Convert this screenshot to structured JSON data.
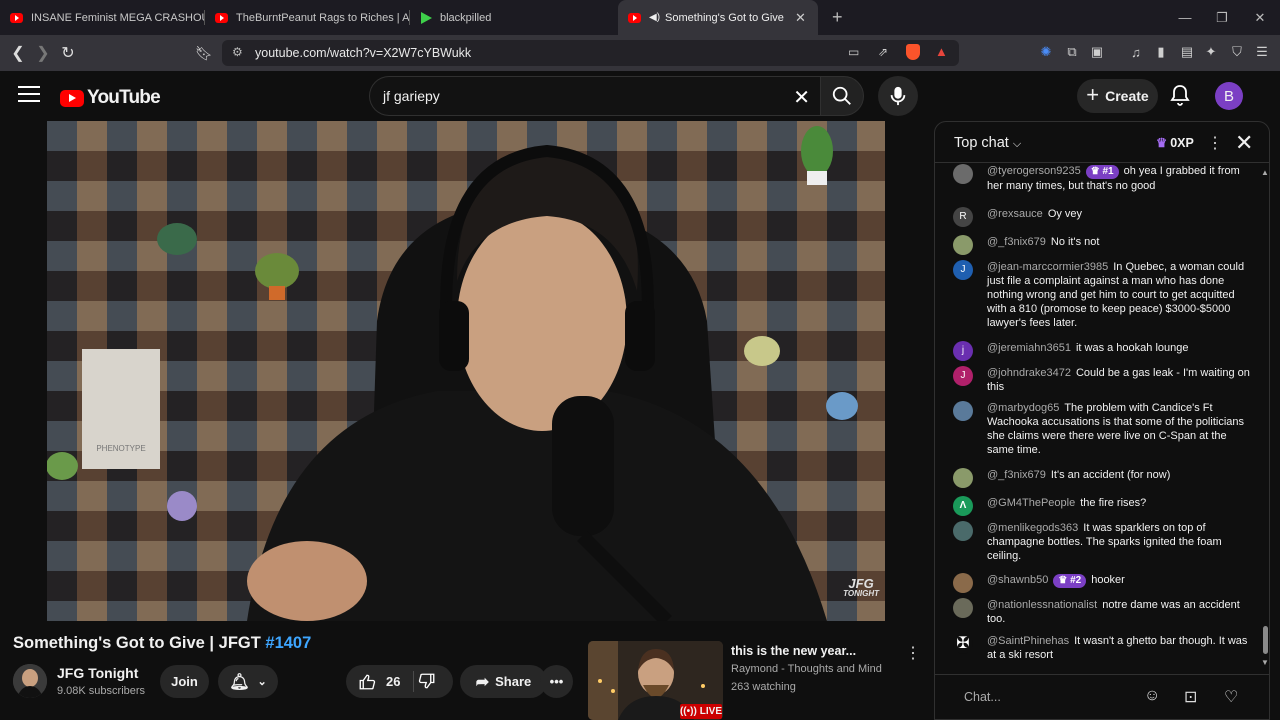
{
  "browser": {
    "tabs": [
      {
        "title": "INSANE Feminist MEGA CRASHOUT",
        "icon": "youtube-icon"
      },
      {
        "title": "TheBurntPeanut Rags to Riches | ARC",
        "icon": "youtube-icon"
      },
      {
        "title": "blackpilled",
        "icon": "rumble-icon"
      },
      {
        "title": "Something's Got to Give | JFG",
        "icon": "youtube-icon",
        "active": true
      }
    ],
    "url": "youtube.com/watch?v=X2W7cYBWukk"
  },
  "youtube": {
    "logo_text": "YouTube",
    "search_value": "jf gariepy",
    "create_label": "Create",
    "avatar_letter": "B",
    "video": {
      "title": "Something's Got to Give | JFGT",
      "hashtag": "#1407",
      "watermark_line1": "JFG",
      "watermark_line2": "TONIGHT"
    },
    "channel": {
      "name": "JFG Tonight",
      "subscribers": "9.08K subscribers"
    },
    "actions": {
      "join": "Join",
      "likes": "26",
      "share": "Share"
    },
    "up_next": {
      "title": "this is the new year...",
      "channel": "Raymond - Thoughts and Mind",
      "watching": "263 watching",
      "live_label": "LIVE"
    }
  },
  "chat": {
    "header": "Top chat",
    "xp": "0XP",
    "input_placeholder": "Chat...",
    "messages": [
      {
        "author": "@tyerogerson9235",
        "badge": "#1",
        "text": "oh yea I grabbed it from her many times, but that's no good",
        "avatar_color": "#6b6b6b",
        "avatar_letter": ""
      },
      {
        "author": "@rexsauce",
        "text": "Oy vey",
        "avatar_color": "#444",
        "avatar_letter": "R"
      },
      {
        "author": "@_f3nix679",
        "text": "No it's not",
        "avatar_color": "#8a9a6a",
        "avatar_letter": ""
      },
      {
        "author": "@jean-marccormier3985",
        "text": "In Quebec, a woman could just file a complaint against a man who has done nothing wrong and get him to court to get acquitted with a 810 (promose to keep peace) $3000-$5000 lawyer's fees later.",
        "avatar_color": "#1f5fb0",
        "avatar_letter": "J"
      },
      {
        "author": "@jeremiahn3651",
        "text": "it was a hookah lounge",
        "avatar_color": "#6a2fb0",
        "avatar_letter": "j"
      },
      {
        "author": "@johndrake3472",
        "text": "Could be a gas leak - I'm waiting on this",
        "avatar_color": "#b0206a",
        "avatar_letter": "J"
      },
      {
        "author": "@marbydog65",
        "text": "The problem with Candice's Ft Wachooka accusations is that some of the politicians she claims were there were live on C-Span at the same time.",
        "avatar_color": "#5a7a9a",
        "avatar_letter": ""
      },
      {
        "author": "@_f3nix679",
        "text": "It's an accident (for now)",
        "avatar_color": "#8a9a6a",
        "avatar_letter": ""
      },
      {
        "author": "@GM4ThePeople",
        "text": "the fire rises?",
        "avatar_color": "#1a9a5a",
        "avatar_letter": "Λ"
      },
      {
        "author": "@menlikegods363",
        "text": "It was sparklers on top of champagne bottles. The sparks ignited the foam ceiling.",
        "avatar_color": "#4a6a6a",
        "avatar_letter": ""
      },
      {
        "author": "@shawnb50",
        "badge": "#2",
        "text": "hooker",
        "avatar_color": "#8a6a4a",
        "avatar_letter": ""
      },
      {
        "author": "@nationlessnationalist",
        "text": "notre dame was an accident too.",
        "avatar_color": "#6a6a5a",
        "avatar_letter": ""
      },
      {
        "author": "@SaintPhinehas",
        "text": "It wasn't a ghetto bar though. It was at a ski resort",
        "avatar_color": "#0f0f0f",
        "avatar_letter": "✠"
      }
    ]
  },
  "colors": {
    "accent_blue": "#3ea6ff",
    "yt_red": "#ff0000",
    "member_purple": "#7b3fc4"
  }
}
